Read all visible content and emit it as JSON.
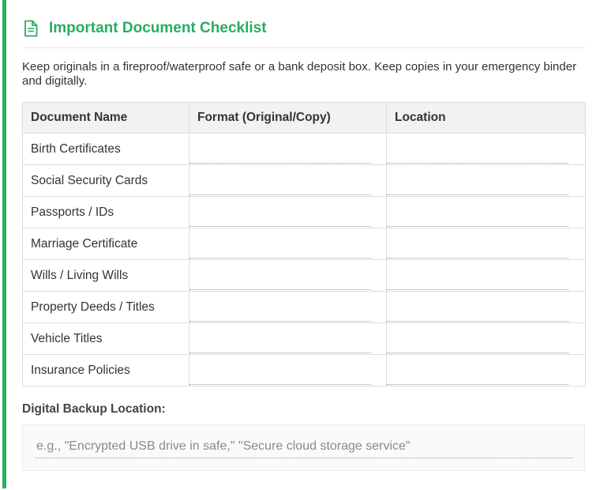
{
  "colors": {
    "accent": "#27ae60",
    "header_bg": "#f2f2f2",
    "text": "#333333"
  },
  "header": {
    "icon": "document-icon",
    "title": "Important Document Checklist"
  },
  "intro": "Keep originals in a fireproof/waterproof safe or a bank deposit box. Keep copies in your emergency binder and digitally.",
  "table": {
    "columns": [
      "Document Name",
      "Format (Original/Copy)",
      "Location"
    ],
    "rows": [
      {
        "document": "Birth Certificates",
        "format": "",
        "location": ""
      },
      {
        "document": "Social Security Cards",
        "format": "",
        "location": ""
      },
      {
        "document": "Passports / IDs",
        "format": "",
        "location": ""
      },
      {
        "document": "Marriage Certificate",
        "format": "",
        "location": ""
      },
      {
        "document": "Wills / Living Wills",
        "format": "",
        "location": ""
      },
      {
        "document": "Property Deeds / Titles",
        "format": "",
        "location": ""
      },
      {
        "document": "Vehicle Titles",
        "format": "",
        "location": ""
      },
      {
        "document": "Insurance Policies",
        "format": "",
        "location": ""
      }
    ]
  },
  "backup": {
    "label": "Digital Backup Location:",
    "value": "",
    "placeholder": "e.g., \"Encrypted USB drive in safe,\" \"Secure cloud storage service\""
  }
}
